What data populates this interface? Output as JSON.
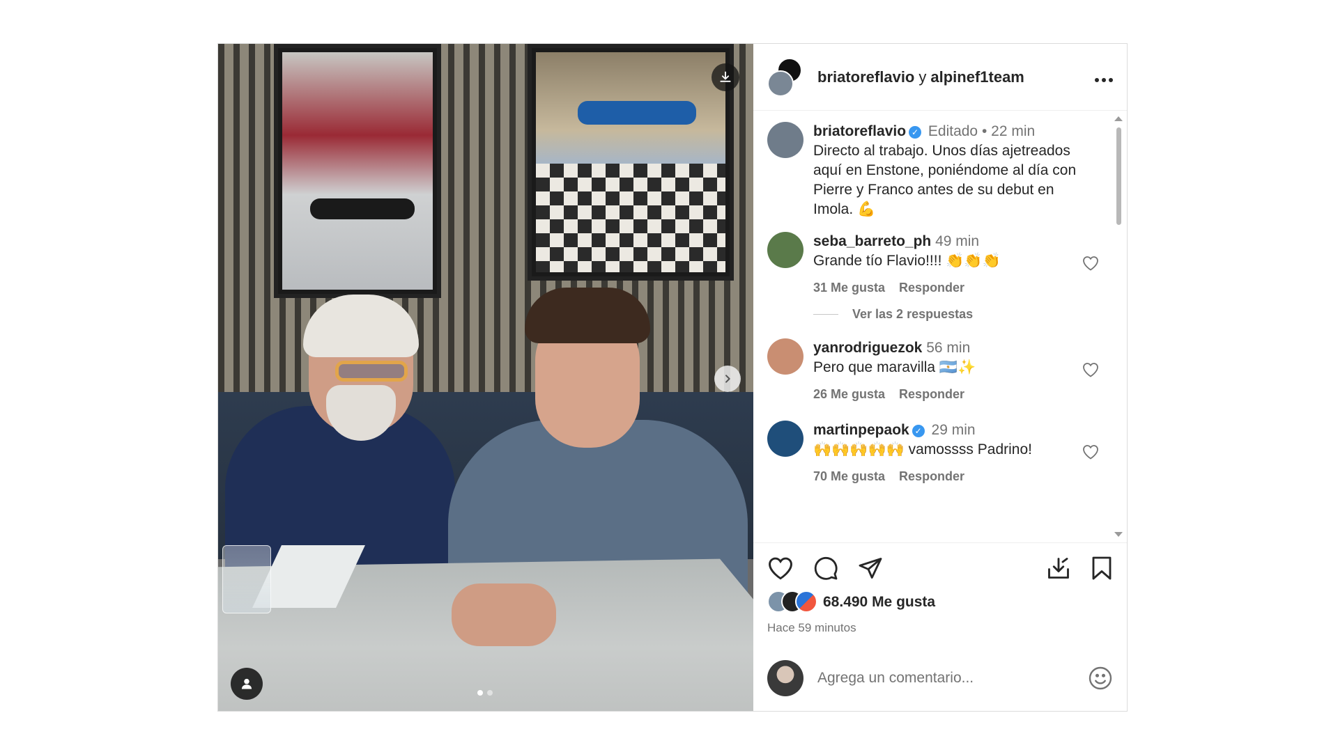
{
  "post": {
    "header": {
      "author": "briatoreflavio",
      "connector": "y",
      "coauthor": "alpinef1team",
      "more_icon": "ellipsis-icon"
    },
    "caption": {
      "user": "briatoreflavio",
      "verified": true,
      "edited": "Editado",
      "separator": "•",
      "time": "22 min",
      "text": "Directo al trabajo. Unos días ajetreados aquí en Enstone, poniéndome al día con Pierre y Franco antes de su debut en Imola. 💪"
    },
    "comments": [
      {
        "user": "seba_barreto_ph",
        "verified": false,
        "time": "49 min",
        "text": "Grande tío Flavio!!!! 👏👏👏",
        "likes": "31 Me gusta",
        "reply": "Responder",
        "avatar_color": "#5a7a4a"
      },
      {
        "user": "yanrodriguezok",
        "verified": false,
        "time": "56 min",
        "text": "Pero que maravilla 🇦🇷✨",
        "likes": "26 Me gusta",
        "reply": "Responder",
        "avatar_color": "#c98e72"
      },
      {
        "user": "martinpepaok",
        "verified": true,
        "time": "29 min",
        "text": "🙌🙌🙌🙌🙌 vamossss Padrino!",
        "likes": "70 Me gusta",
        "reply": "Responder",
        "avatar_color": "#1f4e7a"
      }
    ],
    "view_replies": "Ver las 2 respuestas",
    "likes": "68.490 Me gusta",
    "posted": "Hace 59 minutos",
    "add_comment_placeholder": "Agrega un comentario...",
    "carousel": {
      "current": 1,
      "total": 2
    }
  },
  "colors": {
    "verified": "#3897f0",
    "muted": "#737373",
    "text": "#262626"
  }
}
